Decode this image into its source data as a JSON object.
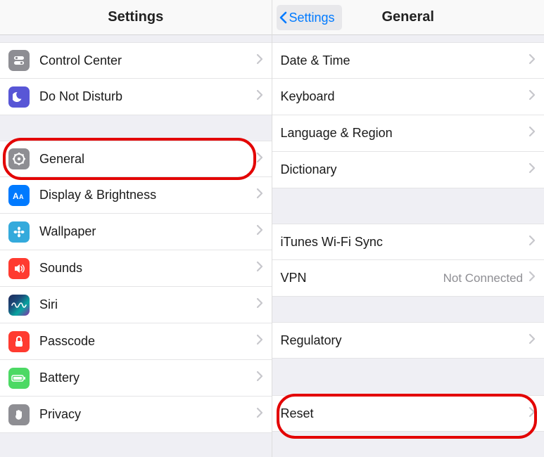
{
  "left": {
    "title": "Settings",
    "groups": [
      [
        {
          "id": "control-center",
          "label": "Control Center"
        },
        {
          "id": "dnd",
          "label": "Do Not Disturb"
        }
      ],
      [
        {
          "id": "general",
          "label": "General"
        },
        {
          "id": "display",
          "label": "Display & Brightness"
        },
        {
          "id": "wallpaper",
          "label": "Wallpaper"
        },
        {
          "id": "sounds",
          "label": "Sounds"
        },
        {
          "id": "siri",
          "label": "Siri"
        },
        {
          "id": "passcode",
          "label": "Passcode"
        },
        {
          "id": "battery",
          "label": "Battery"
        },
        {
          "id": "privacy",
          "label": "Privacy"
        }
      ]
    ]
  },
  "right": {
    "back": "Settings",
    "title": "General",
    "groups": [
      [
        {
          "id": "datetime",
          "label": "Date & Time"
        },
        {
          "id": "keyboard",
          "label": "Keyboard"
        },
        {
          "id": "language",
          "label": "Language & Region"
        },
        {
          "id": "dictionary",
          "label": "Dictionary"
        }
      ],
      [
        {
          "id": "itunes-wifi",
          "label": "iTunes Wi-Fi Sync"
        },
        {
          "id": "vpn",
          "label": "VPN",
          "value": "Not Connected"
        }
      ],
      [
        {
          "id": "regulatory",
          "label": "Regulatory"
        }
      ],
      [
        {
          "id": "reset",
          "label": "Reset"
        }
      ]
    ]
  }
}
